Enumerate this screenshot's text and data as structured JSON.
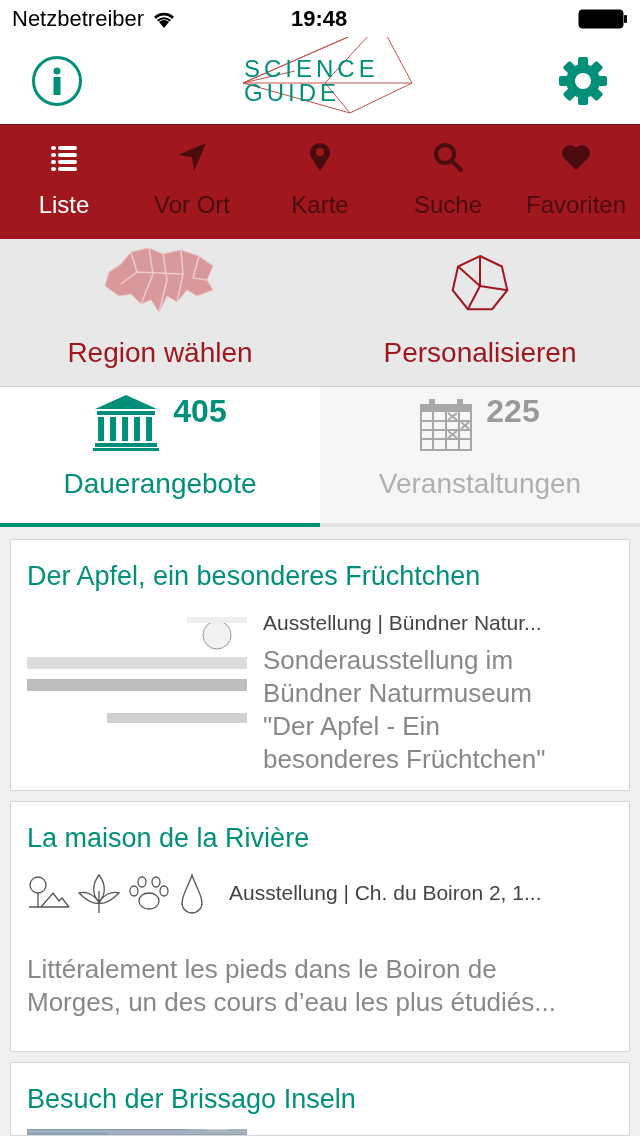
{
  "status_bar": {
    "carrier": "Netzbetreiber",
    "time": "19:48"
  },
  "header": {
    "logo": [
      "SCIENCE",
      "GUIDE"
    ]
  },
  "nav_tabs": [
    {
      "label": "Liste",
      "selected": true
    },
    {
      "label": "Vor Ort",
      "selected": false
    },
    {
      "label": "Karte",
      "selected": false
    },
    {
      "label": "Suche",
      "selected": false
    },
    {
      "label": "Favoriten",
      "selected": false
    }
  ],
  "filters": [
    {
      "label": "Region wählen"
    },
    {
      "label": "Personalisieren"
    }
  ],
  "segments": [
    {
      "label": "Dauerangebote",
      "count": "405",
      "selected": true
    },
    {
      "label": "Veranstaltungen",
      "count": "225",
      "selected": false
    }
  ],
  "cards": [
    {
      "title": "Der Apfel, ein besonderes Früchtchen",
      "meta": "Ausstellung | Bündner Natur...",
      "description": "Sonderausstellung im Bündner Naturmuseum \"Der Apfel - Ein besonderes Früchtchen\""
    },
    {
      "kind": "icons",
      "title": "La maison de la Rivière",
      "meta": "Ausstellung | Ch. du Boiron 2, 1...",
      "description": "Littéralement les pieds dans le Boiron de Morges, un des cours d’eau les plus étudiés..."
    },
    {
      "title": "Besuch der Brissago Inseln"
    }
  ]
}
